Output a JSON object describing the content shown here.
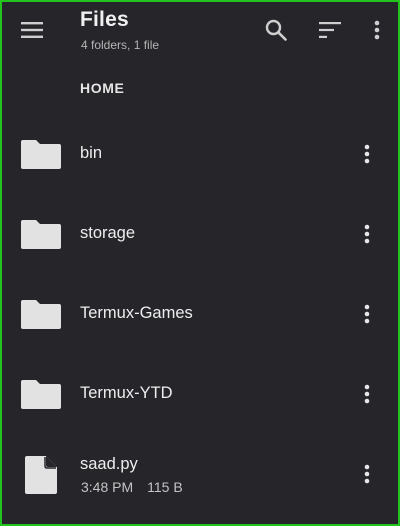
{
  "appbar": {
    "title": "Files",
    "subtitle": "4 folders, 1 file",
    "menu_icon": "hamburger-menu-icon",
    "search_icon": "search-icon",
    "sort_icon": "sort-icon",
    "more_icon": "more-vertical-icon"
  },
  "breadcrumb": {
    "label": "HOME"
  },
  "entries": [
    {
      "type": "folder",
      "name": "bin",
      "icon": "folder-icon"
    },
    {
      "type": "folder",
      "name": "storage",
      "icon": "folder-icon"
    },
    {
      "type": "folder",
      "name": "Termux-Games",
      "icon": "folder-icon"
    },
    {
      "type": "folder",
      "name": "Termux-YTD",
      "icon": "folder-icon"
    },
    {
      "type": "file",
      "name": "saad.py",
      "time": "3:48 PM",
      "size": "115 B",
      "icon": "file-icon"
    }
  ],
  "colors": {
    "background": "#25252a",
    "border": "#22c21f",
    "icon": "#e2e2e2",
    "text": "#eeeeee",
    "secondary_text": "#b5b5b5"
  }
}
